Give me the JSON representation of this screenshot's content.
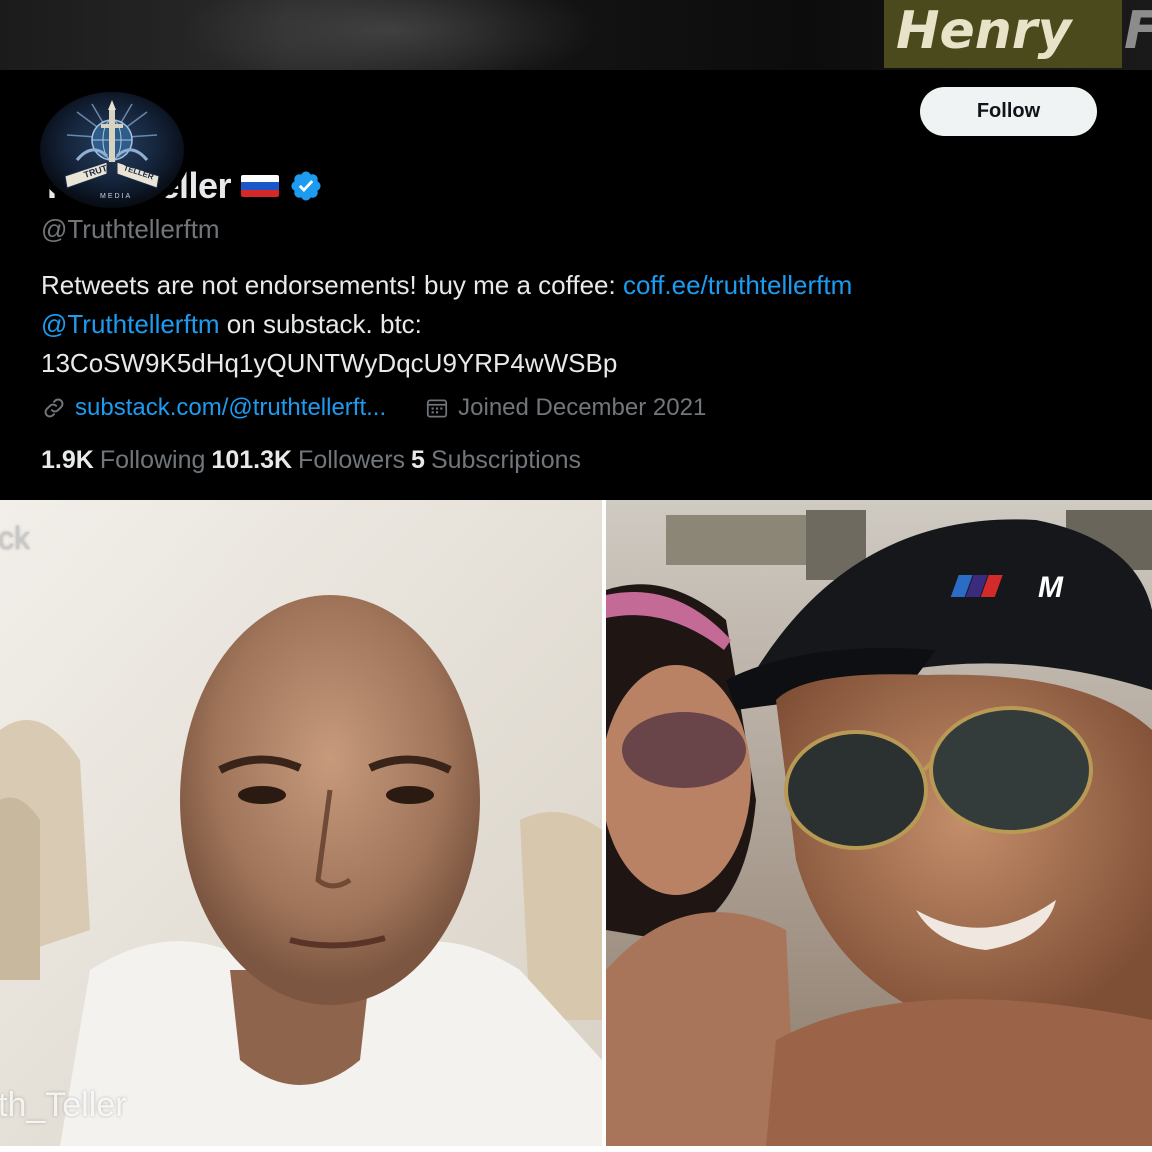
{
  "banner": {
    "overlay_name": "Henry",
    "overlay_name_cut": "F",
    "name_bg_color": "#4a4a1c"
  },
  "avatar": {
    "icon": "truth-teller-media-logo",
    "logo_text_top": "TRUTH",
    "logo_text_right": "TELLER",
    "logo_text_bottom": "MEDIA"
  },
  "follow_button": {
    "label": "Follow"
  },
  "profile": {
    "display_name": "Truth_teller",
    "flag_icon": "russia-flag-icon",
    "verified_icon": "verified-badge-icon",
    "handle": "@Truthtellerftm",
    "bio": {
      "line1_text": "Retweets are not endorsements! buy me a coffee: ",
      "line1_link": "coff.ee/truthtellerftm",
      "line2_mention": "@Truthtellerftm",
      "line2_text": " on substack. btc:",
      "line3_text": "13CoSW9K5dHq1yQUNTWyDqcU9YRP4wWSBp"
    },
    "website": "substack.com/@truthtellerft...",
    "joined": "Joined December 2021",
    "following_count": "1.9K",
    "following_label": "Following",
    "followers_count": "101.3K",
    "followers_label": "Followers",
    "subscriptions_count": "5",
    "subscriptions_label": "Subscriptions"
  },
  "photos": {
    "left_watermark_top": "ck",
    "left_watermark_bottom": "th_Teller",
    "right_cap_logo": "M"
  },
  "colors": {
    "background": "#000000",
    "text_primary": "#e7e9ea",
    "text_secondary": "#71767b",
    "link": "#1d9bf0",
    "button_bg": "#eff3f4"
  }
}
